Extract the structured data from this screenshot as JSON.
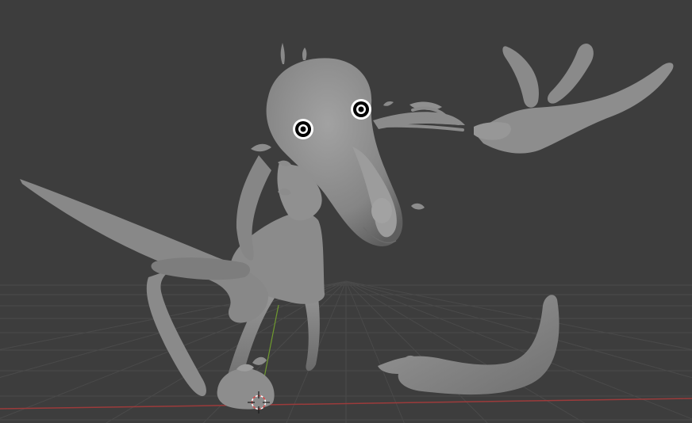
{
  "viewport": {
    "background": "#3d3d3d",
    "grid_color": "#4a4a4a",
    "x_axis_color": "#9c3b3b",
    "y_axis_color": "#6f9a2f",
    "mesh_color": "#8a8a8a",
    "mesh_shadow": "#5f5f5f",
    "mesh_highlight": "#a5a5a5",
    "eye_color": "#000000",
    "eye_ring": "#ffffff"
  },
  "scene": {
    "objects": [
      "creature-body",
      "creature-head",
      "creature-hand",
      "creature-tail",
      "creature-foot"
    ],
    "cursor": "3d-cursor-icon"
  }
}
